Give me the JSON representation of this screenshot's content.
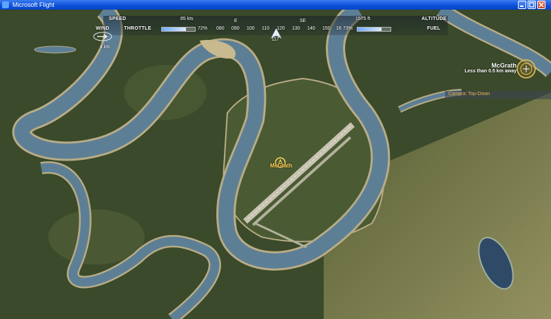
{
  "window": {
    "title": "Microsoft Flight"
  },
  "hud": {
    "speed_label": "SPEED",
    "speed_value": "85 kts",
    "altitude_label": "ALTITUDE",
    "altitude_value": "1575 ft",
    "throttle_label": "THROTTLE",
    "throttle_value": "72%",
    "throttle_level": 72,
    "fuel_label": "FUEL",
    "fuel_value": "73%",
    "fuel_level": 73,
    "wind_label": "WIND",
    "wind_value": "4 kts",
    "heading_value": "117",
    "heading_ticks": [
      "080",
      "090",
      "100",
      "110",
      "120",
      "130",
      "140",
      "150",
      "16"
    ],
    "compass_marks": [
      "E",
      "SE"
    ]
  },
  "destination": {
    "name": "McGrath",
    "distance": "Less than 0.5 km away"
  },
  "camera": {
    "mode": "Camera: Top-Down"
  },
  "map": {
    "airport_label": "McGrath"
  },
  "colors": {
    "title_bar": "#0a4fd8",
    "river": "#5d7f96",
    "forest": "#3a4a2a",
    "tundra": "#8e8c5a",
    "hud_text": "#ffffff",
    "accent": "#f0b24a"
  },
  "icons": [
    "app-icon",
    "wind-arrow-icon",
    "aircraft-icon",
    "destination-marker-icon",
    "airport-marker-icon"
  ]
}
